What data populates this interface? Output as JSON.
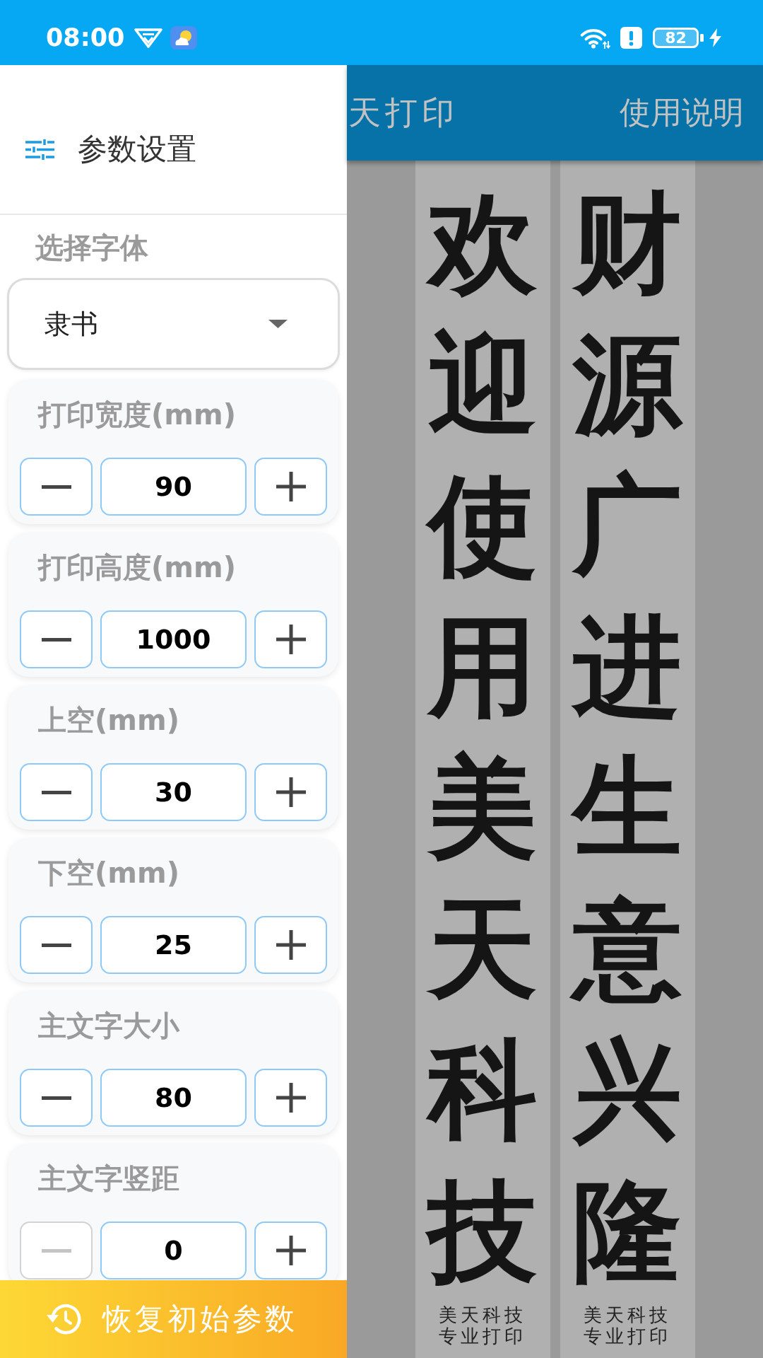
{
  "status_bar": {
    "time": "08:00",
    "battery": "82"
  },
  "drawer": {
    "title": "参数设置",
    "font_label": "选择字体",
    "font_value": "隶书",
    "params": [
      {
        "label": "打印宽度(mm)",
        "value": "90",
        "minus_disabled": false
      },
      {
        "label": "打印高度(mm)",
        "value": "1000",
        "minus_disabled": false
      },
      {
        "label": "上空(mm)",
        "value": "30",
        "minus_disabled": false
      },
      {
        "label": "下空(mm)",
        "value": "25",
        "minus_disabled": false
      },
      {
        "label": "主文字大小",
        "value": "80",
        "minus_disabled": false
      },
      {
        "label": "主文字竖距",
        "value": "0",
        "minus_disabled": true
      }
    ],
    "reset_button": "恢复初始参数"
  },
  "app_bar": {
    "title": "天打印",
    "action": "使用说明"
  },
  "preview": {
    "strips": [
      {
        "text": "欢迎使用美天科技",
        "footer": [
          "美天科技",
          "专业打印"
        ]
      },
      {
        "text": "财源广进生意兴隆",
        "footer": [
          "美天科技",
          "专业打印"
        ]
      }
    ]
  }
}
